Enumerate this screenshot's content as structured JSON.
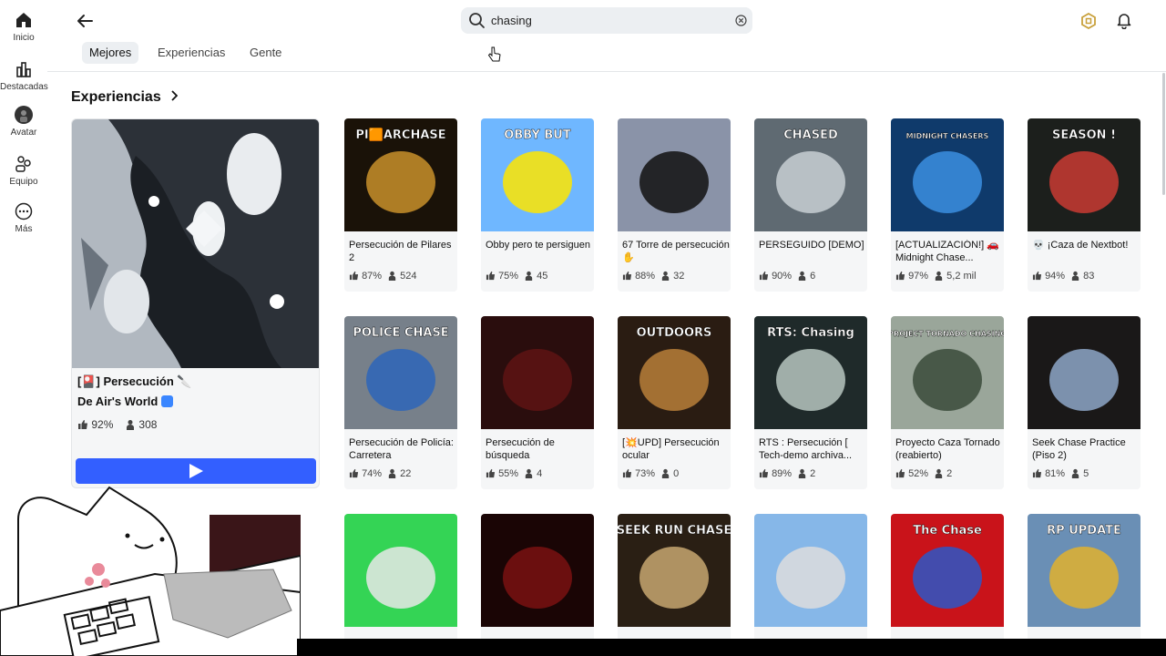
{
  "nav": {
    "items": [
      {
        "label": "Inicio",
        "icon": "home-icon"
      },
      {
        "label": "Destacadas",
        "icon": "charts-icon"
      },
      {
        "label": "Avatar",
        "icon": "avatar-icon"
      },
      {
        "label": "Equipo",
        "icon": "group-icon"
      },
      {
        "label": "Más",
        "icon": "more-icon"
      }
    ]
  },
  "search": {
    "value": "chasing"
  },
  "tabs": [
    {
      "label": "Mejores",
      "active": true
    },
    {
      "label": "Experiencias",
      "active": false
    },
    {
      "label": "Gente",
      "active": false
    }
  ],
  "section": {
    "title": "Experiencias"
  },
  "featured": {
    "title": "[🎴] Persecución 🔪",
    "creator": "De Air's World",
    "rating": "92%",
    "players": "308"
  },
  "cards": [
    {
      "name": "Persecución de Pilares 2",
      "rating": "87%",
      "players": "524",
      "art": "PI🟧ARCHASE"
    },
    {
      "name": "Obby pero te persiguen",
      "rating": "75%",
      "players": "45",
      "art": "OBBY BUT"
    },
    {
      "name": "67 Torre de persecución ✋",
      "rating": "88%",
      "players": "32",
      "art": ""
    },
    {
      "name": "PERSEGUIDO [DEMO]",
      "rating": "90%",
      "players": "6",
      "art": "CHASED"
    },
    {
      "name": "[ACTUALIZACIÓN!] 🚗Midnight Chase...",
      "rating": "97%",
      "players": "5,2 mil",
      "art": "MIDNIGHT CHASERS"
    },
    {
      "name": "💀 ¡Caza de Nextbot!",
      "rating": "94%",
      "players": "83",
      "art": "SEASON !"
    },
    {
      "name": "Persecución de Policía: Carretera",
      "rating": "74%",
      "players": "22",
      "art": "POLICE CHASE"
    },
    {
      "name": "Persecución de búsqueda",
      "rating": "55%",
      "players": "4",
      "art": ""
    },
    {
      "name": "[💥UPD] Persecución ocular",
      "rating": "73%",
      "players": "0",
      "art": "OUTDOORS"
    },
    {
      "name": "RTS : Persecución [ Tech-demo archiva...",
      "rating": "89%",
      "players": "2",
      "art": "RTS: Chasing"
    },
    {
      "name": "Proyecto Caza Tornado (reabierto)",
      "rating": "52%",
      "players": "2",
      "art": "PROJECT TORNADO CHASING"
    },
    {
      "name": "Seek Chase Practice (Piso 2)",
      "rating": "81%",
      "players": "5",
      "art": ""
    },
    {
      "name": "",
      "rating": "",
      "players": "",
      "art": ""
    },
    {
      "name": "",
      "rating": "",
      "players": "",
      "art": ""
    },
    {
      "name": "",
      "rating": "",
      "players": "",
      "art": "SEEK RUN CHASE"
    },
    {
      "name": "",
      "rating": "",
      "players": "",
      "art": ""
    },
    {
      "name": "",
      "rating": "",
      "players": "",
      "art": "The Chase"
    },
    {
      "name": "",
      "rating": "",
      "players": "",
      "art": "RP UPDATE"
    }
  ],
  "colors": {
    "accent": "#335fff",
    "bg": "#ffffff",
    "card": "#f5f6f7"
  }
}
